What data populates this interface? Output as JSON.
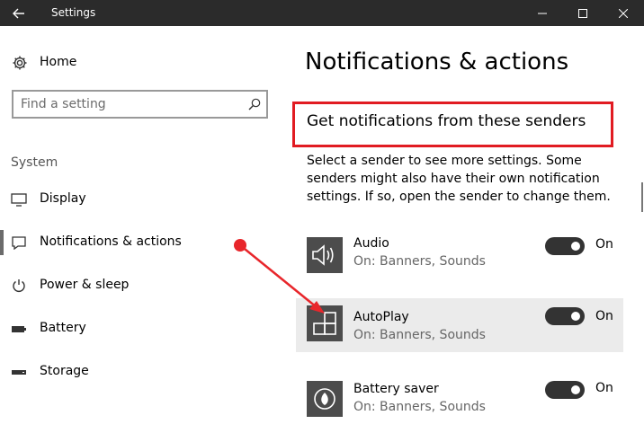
{
  "window": {
    "title": "Settings"
  },
  "sidebar": {
    "home_label": "Home",
    "search_placeholder": "Find a setting",
    "section_label": "System",
    "items": [
      {
        "label": "Display",
        "icon": "display-icon"
      },
      {
        "label": "Notifications & actions",
        "icon": "notification-icon",
        "selected": true
      },
      {
        "label": "Power & sleep",
        "icon": "power-icon"
      },
      {
        "label": "Battery",
        "icon": "battery-icon"
      },
      {
        "label": "Storage",
        "icon": "storage-icon"
      }
    ]
  },
  "main": {
    "title": "Notifications & actions",
    "section_title": "Get notifications from these senders",
    "description": "Select a sender to see more settings. Some senders might also have their own notification settings. If so, open the sender to change them.",
    "senders": [
      {
        "name": "Audio",
        "status": "On: Banners, Sounds",
        "toggle": "On",
        "icon": "speaker-icon"
      },
      {
        "name": "AutoPlay",
        "status": "On: Banners, Sounds",
        "toggle": "On",
        "icon": "autoplay-icon"
      },
      {
        "name": "Battery saver",
        "status": "On: Banners, Sounds",
        "toggle": "On",
        "icon": "battery-saver-icon"
      }
    ]
  },
  "colors": {
    "titlebar": "#2b2b2b",
    "highlight_box": "#e11b22",
    "annotation_arrow": "#e8262b",
    "tile": "#4c4c4c",
    "toggle_on": "#333333"
  }
}
